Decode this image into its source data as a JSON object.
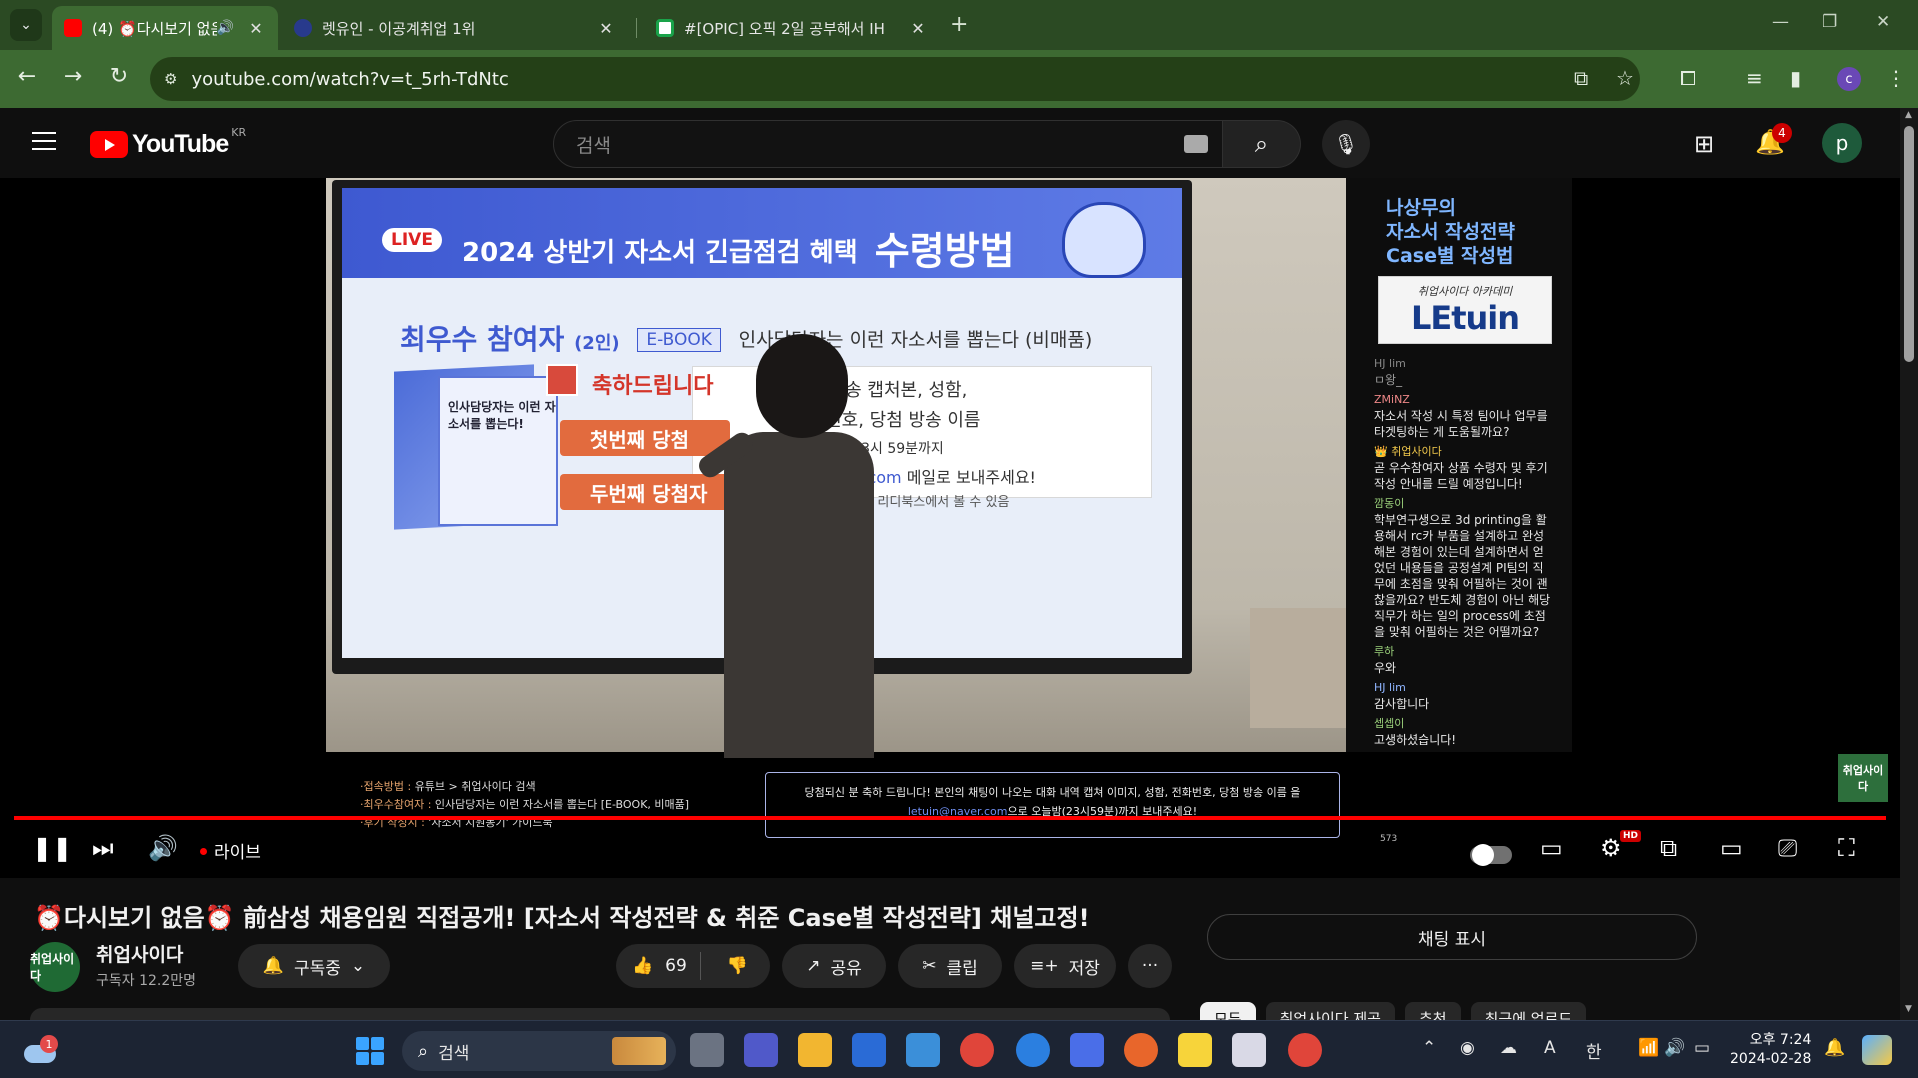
{
  "browser": {
    "tabs": [
      {
        "title": "(4) ⏰다시보기 없음⏰ 前",
        "active": true
      },
      {
        "title": "렛유인 - 이공계취업 1위",
        "active": false
      },
      {
        "title": "#[OPIC] 오픽 2일 공부해서 IH",
        "active": false
      }
    ],
    "url": "youtube.com/watch?v=t_5rh-TdNtc",
    "profile_initial": "c",
    "colors": {
      "frame": "#2b4a23",
      "toolbar": "#3d6a32"
    }
  },
  "youtube": {
    "logo_text": "YouTube",
    "region": "KR",
    "search_placeholder": "검색",
    "notifications": "4",
    "avatar_initial": "p",
    "accent": "#ff0000"
  },
  "video": {
    "slide": {
      "live": "LIVE",
      "title_a": "2024 상반기 자소서 긴급점검 혜택",
      "title_b": "수령방법",
      "winner_label": "최우수 참여자",
      "winner_count": "(2인)",
      "ebook_tag": "E-BOOK",
      "ebook_desc": "인사담당자는 이런 자소서를 뽑는다 (비매품)",
      "book_title": "인사담당자는 이런 자소서를 뽑는다!",
      "congrats": "축하드립니다",
      "win1": "첫번째 당첨",
      "win2": "두번째 당첨자",
      "info1": "생방송 캡처본, 성함,",
      "info2": "전화번호, 당첨 방송 이름",
      "info3": "금일 23시 59분까지",
      "info4_email": "@naver.com",
      "info4_rest": " 메일로 보내주세요!",
      "info5": "] E-BOOK은 리디북스에서 볼 수 있음"
    },
    "overlay": {
      "title_lines": [
        "나상무의",
        "자소서 작성전략",
        "Case별 작성법"
      ],
      "logo_small": "취업사이다 아카데미",
      "logo_brand": "LEtuin"
    },
    "chat": [
      {
        "user": "HJ lim",
        "text": "ㅁ왕_",
        "dim": true
      },
      {
        "user": "ZMiNZ",
        "text": "자소서 작성 시 특정 팀이나 업무를 타겟팅하는 게 도움될까요?"
      },
      {
        "user": "👑 취업사이다",
        "text": "곧 우수참여자 상품 수령자 및 후기작성 안내를 드릴 예정입니다!"
      },
      {
        "user": "깜동이",
        "text": "학부연구생으로 3d printing을 활용해서 rc카 부품을 설계하고 완성해본 경험이 있는데 설계하면서 얻었던 내용들을 공정설계 PI팀의 직무에 초점을 맞춰 어필하는 것이 괜찮을까요? 반도체 경험이 아닌 해당 직무가 하는 일의 process에 초점을 맞춰 어필하는 것은 어떨까요?"
      },
      {
        "user": "루하",
        "text": "우와"
      },
      {
        "user": "HJ lim",
        "text": "감사합니다"
      },
      {
        "user": "셉셉이",
        "text": "고생하셨습니다!"
      }
    ],
    "chat_count": "573",
    "caption_left": [
      {
        "k": "·접속방법 : ",
        "v": "유튜브 > 취업사이다 검색"
      },
      {
        "k": "·최우수참여자 : ",
        "v": "인사담당자는 이런 자소서를 뽑는다 [E-BOOK, 비매품]"
      },
      {
        "k": "·후기 작성시 : ",
        "v": "'자소서 지원동기' 가이드북"
      }
    ],
    "caption_box_line1": "당첨되신 분 축하 드립니다! 본인의 채팅이 나오는 대화 내역 캡쳐 이미지, 성함, 전화번호, 당첨 방송 이름 을",
    "caption_box_email": "letuin@naver.com",
    "caption_box_line2": "으로 오늘밤(23시59분)까지 보내주세요!",
    "corner_logo": "취업사이다",
    "live_label": "라이브",
    "hd": "HD"
  },
  "meta": {
    "title": "⏰다시보기 없음⏰ 前삼성 채용임원 직접공개! [자소서 작성전략 & 취준 Case별 작성전략] 채널고정!",
    "channel": "취업사이다",
    "channel_avatar": "취업사이다",
    "subscribers": "구독자 12.2만명",
    "subscribe_label": "구독중",
    "likes": "69",
    "share": "공유",
    "clip": "클립",
    "save": "저장",
    "more": "···",
    "chat_toggle": "채팅 표시",
    "chips": [
      "모두",
      "취업사이다 제공",
      "추천",
      "최근에 업로드"
    ]
  },
  "taskbar": {
    "weather_badge": "1",
    "search": "검색",
    "ime_a": "A",
    "ime_han": "한",
    "time": "오후 7:24",
    "date": "2024-02-28"
  }
}
